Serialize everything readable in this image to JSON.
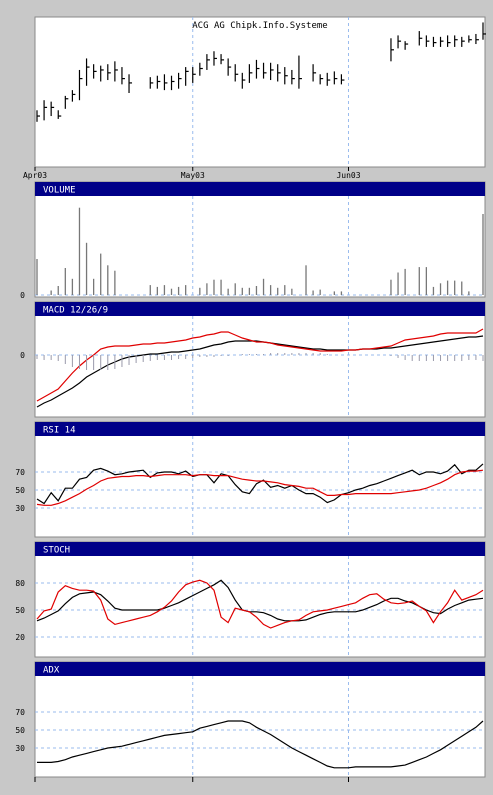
{
  "chart_data": {
    "type": "stock-panels",
    "title": "ACG AG Chipk.Info.Systeme",
    "x": {
      "count": 64,
      "month_labels": [
        {
          "index": 0,
          "label": "Apr03"
        },
        {
          "index": 22,
          "label": "May03"
        },
        {
          "index": 44,
          "label": "Jun03"
        }
      ]
    },
    "panels": [
      {
        "id": "price",
        "type": "ohlc",
        "title": "ACG AG Chipk.Info.Systeme",
        "ylim": [
          0,
          100
        ],
        "ohlc": [
          {
            "h": 38,
            "l": 30,
            "c": 34
          },
          {
            "h": 45,
            "l": 31,
            "c": 40
          },
          {
            "h": 44,
            "l": 34,
            "c": 40
          },
          {
            "h": 38,
            "l": 32,
            "c": 34
          },
          {
            "h": 48,
            "l": 39,
            "c": 46
          },
          {
            "h": 52,
            "l": 44,
            "c": 49
          },
          {
            "h": 66,
            "l": 45,
            "c": 60
          },
          {
            "h": 74,
            "l": 55,
            "c": 68
          },
          {
            "h": 70,
            "l": 60,
            "c": 65
          },
          {
            "h": 69,
            "l": 58,
            "c": 66
          },
          {
            "h": 70,
            "l": 59,
            "c": 64
          },
          {
            "h": 72,
            "l": 58,
            "c": 66
          },
          {
            "h": 68,
            "l": 56,
            "c": 60
          },
          {
            "h": 63,
            "l": 50,
            "c": 57
          },
          {
            "h": null,
            "l": null,
            "c": null
          },
          {
            "h": null,
            "l": null,
            "c": null
          },
          {
            "h": 61,
            "l": 53,
            "c": 57
          },
          {
            "h": 62,
            "l": 53,
            "c": 58
          },
          {
            "h": 63,
            "l": 52,
            "c": 57
          },
          {
            "h": 62,
            "l": 52,
            "c": 58
          },
          {
            "h": 64,
            "l": 53,
            "c": 60
          },
          {
            "h": 68,
            "l": 55,
            "c": 65
          },
          {
            "h": 68,
            "l": 57,
            "c": 63
          },
          {
            "h": 71,
            "l": 62,
            "c": 67
          },
          {
            "h": 77,
            "l": 66,
            "c": 73
          },
          {
            "h": 79,
            "l": 69,
            "c": 74
          },
          {
            "h": 77,
            "l": 70,
            "c": 73
          },
          {
            "h": 74,
            "l": 62,
            "c": 68
          },
          {
            "h": 70,
            "l": 58,
            "c": 63
          },
          {
            "h": 64,
            "l": 53,
            "c": 59
          },
          {
            "h": 70,
            "l": 57,
            "c": 64
          },
          {
            "h": 73,
            "l": 60,
            "c": 67
          },
          {
            "h": 71,
            "l": 60,
            "c": 64
          },
          {
            "h": 71,
            "l": 59,
            "c": 66
          },
          {
            "h": 70,
            "l": 58,
            "c": 64
          },
          {
            "h": 68,
            "l": 56,
            "c": 62
          },
          {
            "h": 66,
            "l": 56,
            "c": 60
          },
          {
            "h": 76,
            "l": 53,
            "c": 60
          },
          {
            "h": null,
            "l": null,
            "c": null
          },
          {
            "h": 70,
            "l": 58,
            "c": 64
          },
          {
            "h": 63,
            "l": 56,
            "c": 60
          },
          {
            "h": 64,
            "l": 55,
            "c": 59
          },
          {
            "h": 65,
            "l": 56,
            "c": 60
          },
          {
            "h": 63,
            "l": 56,
            "c": 59
          },
          {
            "h": null,
            "l": null,
            "c": null
          },
          {
            "h": null,
            "l": null,
            "c": null
          },
          {
            "h": null,
            "l": null,
            "c": null
          },
          {
            "h": null,
            "l": null,
            "c": null
          },
          {
            "h": null,
            "l": null,
            "c": null
          },
          {
            "h": null,
            "l": null,
            "c": null
          },
          {
            "h": 88,
            "l": 72,
            "c": 80
          },
          {
            "h": 90,
            "l": 81,
            "c": 86
          },
          {
            "h": 86,
            "l": 80,
            "c": 84
          },
          {
            "h": null,
            "l": null,
            "c": null
          },
          {
            "h": 93,
            "l": 83,
            "c": 88
          },
          {
            "h": 90,
            "l": 82,
            "c": 86
          },
          {
            "h": 89,
            "l": 82,
            "c": 85
          },
          {
            "h": 89,
            "l": 82,
            "c": 86
          },
          {
            "h": 90,
            "l": 82,
            "c": 85
          },
          {
            "h": 90,
            "l": 82,
            "c": 87
          },
          {
            "h": 89,
            "l": 82,
            "c": 86
          },
          {
            "h": 90,
            "l": 85,
            "c": 87
          },
          {
            "h": 91,
            "l": 84,
            "c": 87
          },
          {
            "h": 99,
            "l": 87,
            "c": 91
          }
        ]
      },
      {
        "id": "volume",
        "type": "bar",
        "title": "VOLUME",
        "ylim": [
          0,
          100
        ],
        "ticks": [
          {
            "value": 0,
            "label": "0"
          }
        ],
        "values": [
          40,
          0,
          5,
          10,
          30,
          18,
          97,
          58,
          18,
          46,
          33,
          27,
          0,
          0,
          0,
          0,
          11,
          9,
          11,
          7,
          9,
          11,
          0,
          8,
          13,
          17,
          17,
          7,
          13,
          8,
          8,
          10,
          18,
          11,
          8,
          11,
          7,
          0,
          33,
          5,
          6,
          0,
          4,
          4,
          0,
          0,
          0,
          0,
          0,
          0,
          17,
          25,
          29,
          0,
          31,
          31,
          9,
          13,
          16,
          16,
          15,
          4,
          0,
          90
        ]
      },
      {
        "id": "macd",
        "type": "line",
        "title": "MACD 12/26/9",
        "ylim": [
          -60,
          30
        ],
        "ticks": [
          {
            "value": 0,
            "label": "0"
          }
        ],
        "series": [
          {
            "color": "#000000",
            "values": [
              -52,
              -48,
              -45,
              -41,
              -37,
              -33,
              -28,
              -22,
              -18,
              -14,
              -10,
              -7,
              -4,
              -2,
              -1,
              0,
              1,
              1,
              2,
              3,
              3,
              4,
              5,
              6,
              8,
              10,
              11,
              13,
              14,
              14,
              14,
              14,
              13,
              12,
              11,
              10,
              9,
              8,
              7,
              6,
              6,
              5,
              5,
              5,
              5,
              5,
              6,
              6,
              6,
              7,
              7,
              8,
              9,
              10,
              11,
              12,
              13,
              14,
              15,
              16,
              17,
              18,
              18,
              19
            ]
          },
          {
            "color": "#e00000",
            "values": [
              -46,
              -42,
              -38,
              -34,
              -26,
              -18,
              -11,
              -5,
              0,
              6,
              8,
              9,
              9,
              9,
              10,
              11,
              11,
              12,
              12,
              13,
              14,
              15,
              17,
              18,
              20,
              21,
              23,
              23,
              20,
              17,
              15,
              13,
              13,
              12,
              10,
              9,
              8,
              7,
              6,
              5,
              4,
              4,
              4,
              4,
              5,
              5,
              6,
              6,
              7,
              8,
              9,
              12,
              15,
              16,
              17,
              18,
              19,
              21,
              22,
              22,
              22,
              22,
              22,
              26
            ]
          },
          {
            "color": "#000000",
            "type": "histogram",
            "values": [
              -4,
              -5,
              -5,
              -6,
              -9,
              -12,
              -14,
              -15,
              -15,
              -15,
              -15,
              -14,
              -12,
              -10,
              -8,
              -7,
              -6,
              -5,
              -5,
              -5,
              -4,
              -4,
              -3,
              -2,
              -2,
              -2,
              -1,
              -1,
              0,
              1,
              1,
              1,
              1,
              2,
              2,
              2,
              2,
              2,
              2,
              2,
              2,
              1,
              0,
              0,
              0,
              0,
              0,
              0,
              0,
              0,
              -1,
              -3,
              -5,
              -6,
              -6,
              -6,
              -6,
              -6,
              -6,
              -6,
              -6,
              -5,
              -5,
              -6
            ]
          }
        ]
      },
      {
        "id": "rsi",
        "type": "line",
        "title": "RSI 14",
        "ylim": [
          0,
          100
        ],
        "ticks": [
          {
            "value": 70,
            "label": "70"
          },
          {
            "value": 50,
            "label": "50"
          },
          {
            "value": 30,
            "label": "30"
          }
        ],
        "series": [
          {
            "color": "#000000",
            "values": [
              40,
              35,
              47,
              38,
              52,
              52,
              62,
              64,
              72,
              74,
              71,
              67,
              68,
              70,
              71,
              72,
              64,
              69,
              70,
              70,
              68,
              71,
              65,
              67,
              67,
              58,
              68,
              66,
              56,
              48,
              46,
              57,
              61,
              53,
              55,
              52,
              55,
              50,
              46,
              46,
              42,
              36,
              39,
              45,
              47,
              50,
              52,
              55,
              57,
              60,
              63,
              66,
              69,
              72,
              67,
              70,
              70,
              68,
              71,
              78,
              68,
              72,
              72,
              79
            ]
          },
          {
            "color": "#e00000",
            "values": [
              34,
              33,
              33,
              35,
              38,
              42,
              46,
              51,
              55,
              60,
              63,
              64,
              65,
              65,
              66,
              66,
              65,
              66,
              67,
              67,
              67,
              67,
              66,
              67,
              67,
              66,
              66,
              66,
              64,
              62,
              61,
              60,
              60,
              59,
              58,
              56,
              55,
              54,
              52,
              52,
              48,
              44,
              44,
              45,
              45,
              46,
              46,
              46,
              46,
              46,
              46,
              47,
              48,
              49,
              50,
              52,
              55,
              58,
              62,
              67,
              70,
              71,
              71,
              72
            ]
          }
        ]
      },
      {
        "id": "stoch",
        "type": "line",
        "title": "STOCH",
        "ylim": [
          0,
          100
        ],
        "ticks": [
          {
            "value": 80,
            "label": "80"
          },
          {
            "value": 50,
            "label": "50"
          },
          {
            "value": 20,
            "label": "20"
          }
        ],
        "series": [
          {
            "color": "#000000",
            "values": [
              38,
              41,
              45,
              49,
              57,
              64,
              68,
              69,
              70,
              67,
              60,
              52,
              50,
              50,
              50,
              50,
              50,
              50,
              52,
              55,
              58,
              62,
              66,
              70,
              74,
              78,
              83,
              75,
              61,
              50,
              48,
              48,
              47,
              44,
              40,
              38,
              38,
              38,
              39,
              42,
              45,
              47,
              48,
              48,
              48,
              48,
              50,
              53,
              56,
              60,
              63,
              63,
              60,
              58,
              54,
              50,
              47,
              46,
              51,
              55,
              58,
              61,
              62,
              63
            ]
          },
          {
            "color": "#e00000",
            "values": [
              40,
              49,
              51,
              70,
              77,
              74,
              72,
              72,
              71,
              61,
              40,
              34,
              36,
              38,
              40,
              42,
              44,
              48,
              53,
              60,
              70,
              78,
              81,
              83,
              80,
              72,
              42,
              36,
              52,
              50,
              48,
              42,
              34,
              30,
              33,
              36,
              38,
              39,
              44,
              48,
              49,
              50,
              52,
              54,
              56,
              58,
              63,
              67,
              68,
              62,
              58,
              57,
              58,
              60,
              54,
              49,
              36,
              48,
              58,
              72,
              61,
              64,
              67,
              72
            ]
          }
        ]
      },
      {
        "id": "adx",
        "type": "line",
        "title": "ADX",
        "ylim": [
          0,
          100
        ],
        "ticks": [
          {
            "value": 70,
            "label": "70"
          },
          {
            "value": 50,
            "label": "50"
          },
          {
            "value": 30,
            "label": "30"
          }
        ],
        "series": [
          {
            "color": "#000000",
            "values": [
              14,
              14,
              14,
              15,
              17,
              20,
              22,
              24,
              26,
              28,
              30,
              31,
              32,
              34,
              36,
              38,
              40,
              42,
              44,
              45,
              46,
              47,
              48,
              52,
              54,
              56,
              58,
              60,
              60,
              60,
              58,
              53,
              49,
              45,
              40,
              35,
              30,
              26,
              22,
              18,
              14,
              10,
              8,
              8,
              8,
              9,
              9,
              9,
              9,
              9,
              9,
              10,
              11,
              14,
              17,
              20,
              24,
              28,
              33,
              38,
              43,
              48,
              53,
              60
            ]
          }
        ]
      }
    ]
  }
}
